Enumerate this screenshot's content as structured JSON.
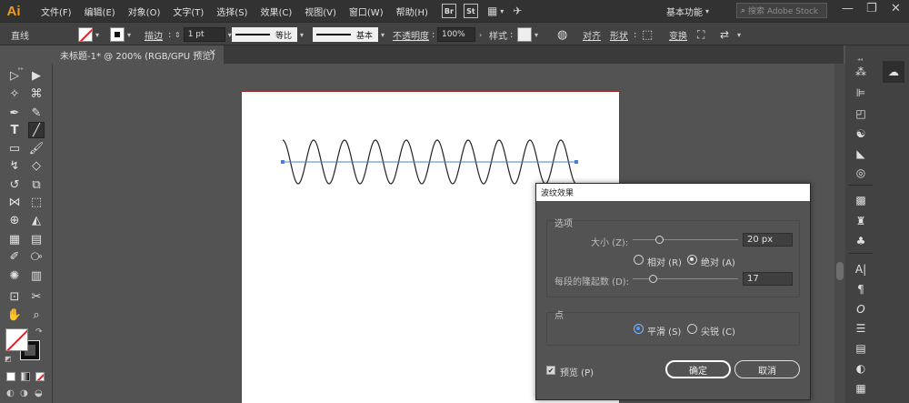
{
  "app": {
    "logo": "Ai"
  },
  "menu": [
    "文件(F)",
    "编辑(E)",
    "对象(O)",
    "文字(T)",
    "选择(S)",
    "效果(C)",
    "视图(V)",
    "窗口(W)",
    "帮助(H)"
  ],
  "menubar": {
    "bridge": "Br",
    "stock": "St",
    "workspace": "基本功能",
    "search_placeholder": "搜索 Adobe Stock",
    "win_minimize": "—",
    "win_restore": "❐",
    "win_close": "✕"
  },
  "control_bar": {
    "tool_name": "直线",
    "stroke_label": "描边",
    "stroke_weight": "1 pt",
    "profile_label": "等比",
    "brush_label": "基本",
    "opacity_label": "不透明度",
    "opacity_value": "100%",
    "style_label": "样式",
    "align_label": "对齐",
    "shape_label": "形状",
    "transform_label": "变换"
  },
  "document": {
    "tab_title": "未标题-1* @ 200% (RGB/GPU 预览)",
    "close_glyph": "✕"
  },
  "dialog": {
    "title": "波纹效果",
    "options_group": "选项",
    "size_label": "大小 (Z):",
    "size_value": "20 px",
    "size_fraction": 0.26,
    "relative_label": "相对 (R)",
    "absolute_label": "绝对 (A)",
    "ridges_label": "每段的隆起数 (D):",
    "ridges_value": "17",
    "ridges_fraction": 0.2,
    "points_group": "点",
    "smooth_label": "平滑 (S)",
    "corner_label": "尖锐 (C)",
    "preview_label": "预览 (P)",
    "ok_label": "确定",
    "cancel_label": "取消"
  },
  "colors": {
    "ui_bg": "#535353",
    "menubar_bg": "#323232",
    "artboard_border": "#9b2b2b",
    "path_selection": "#4a7fd8",
    "radio_selected": "#4a9cff"
  }
}
